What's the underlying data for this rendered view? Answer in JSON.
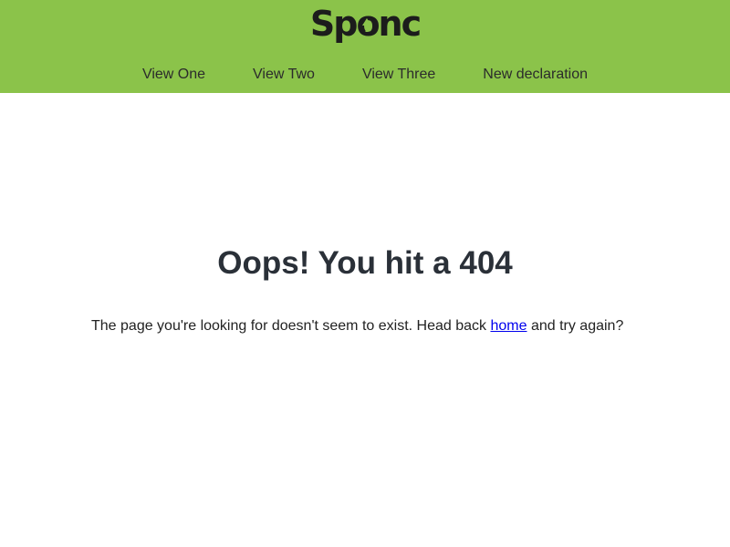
{
  "header": {
    "logo_text_before": "Sp",
    "logo_text_o": "o",
    "logo_text_after": "nc",
    "nav": [
      {
        "label": "View One"
      },
      {
        "label": "View Two"
      },
      {
        "label": "View Three"
      },
      {
        "label": "New declaration"
      }
    ]
  },
  "main": {
    "title": "Oops! You hit a 404",
    "message_before": "The page you're looking for doesn't seem to exist. Head back ",
    "home_link": "home",
    "message_after": " and try again?"
  },
  "colors": {
    "header_bg": "#8bc34a",
    "link": "#0000ee",
    "title": "#2a3038"
  }
}
